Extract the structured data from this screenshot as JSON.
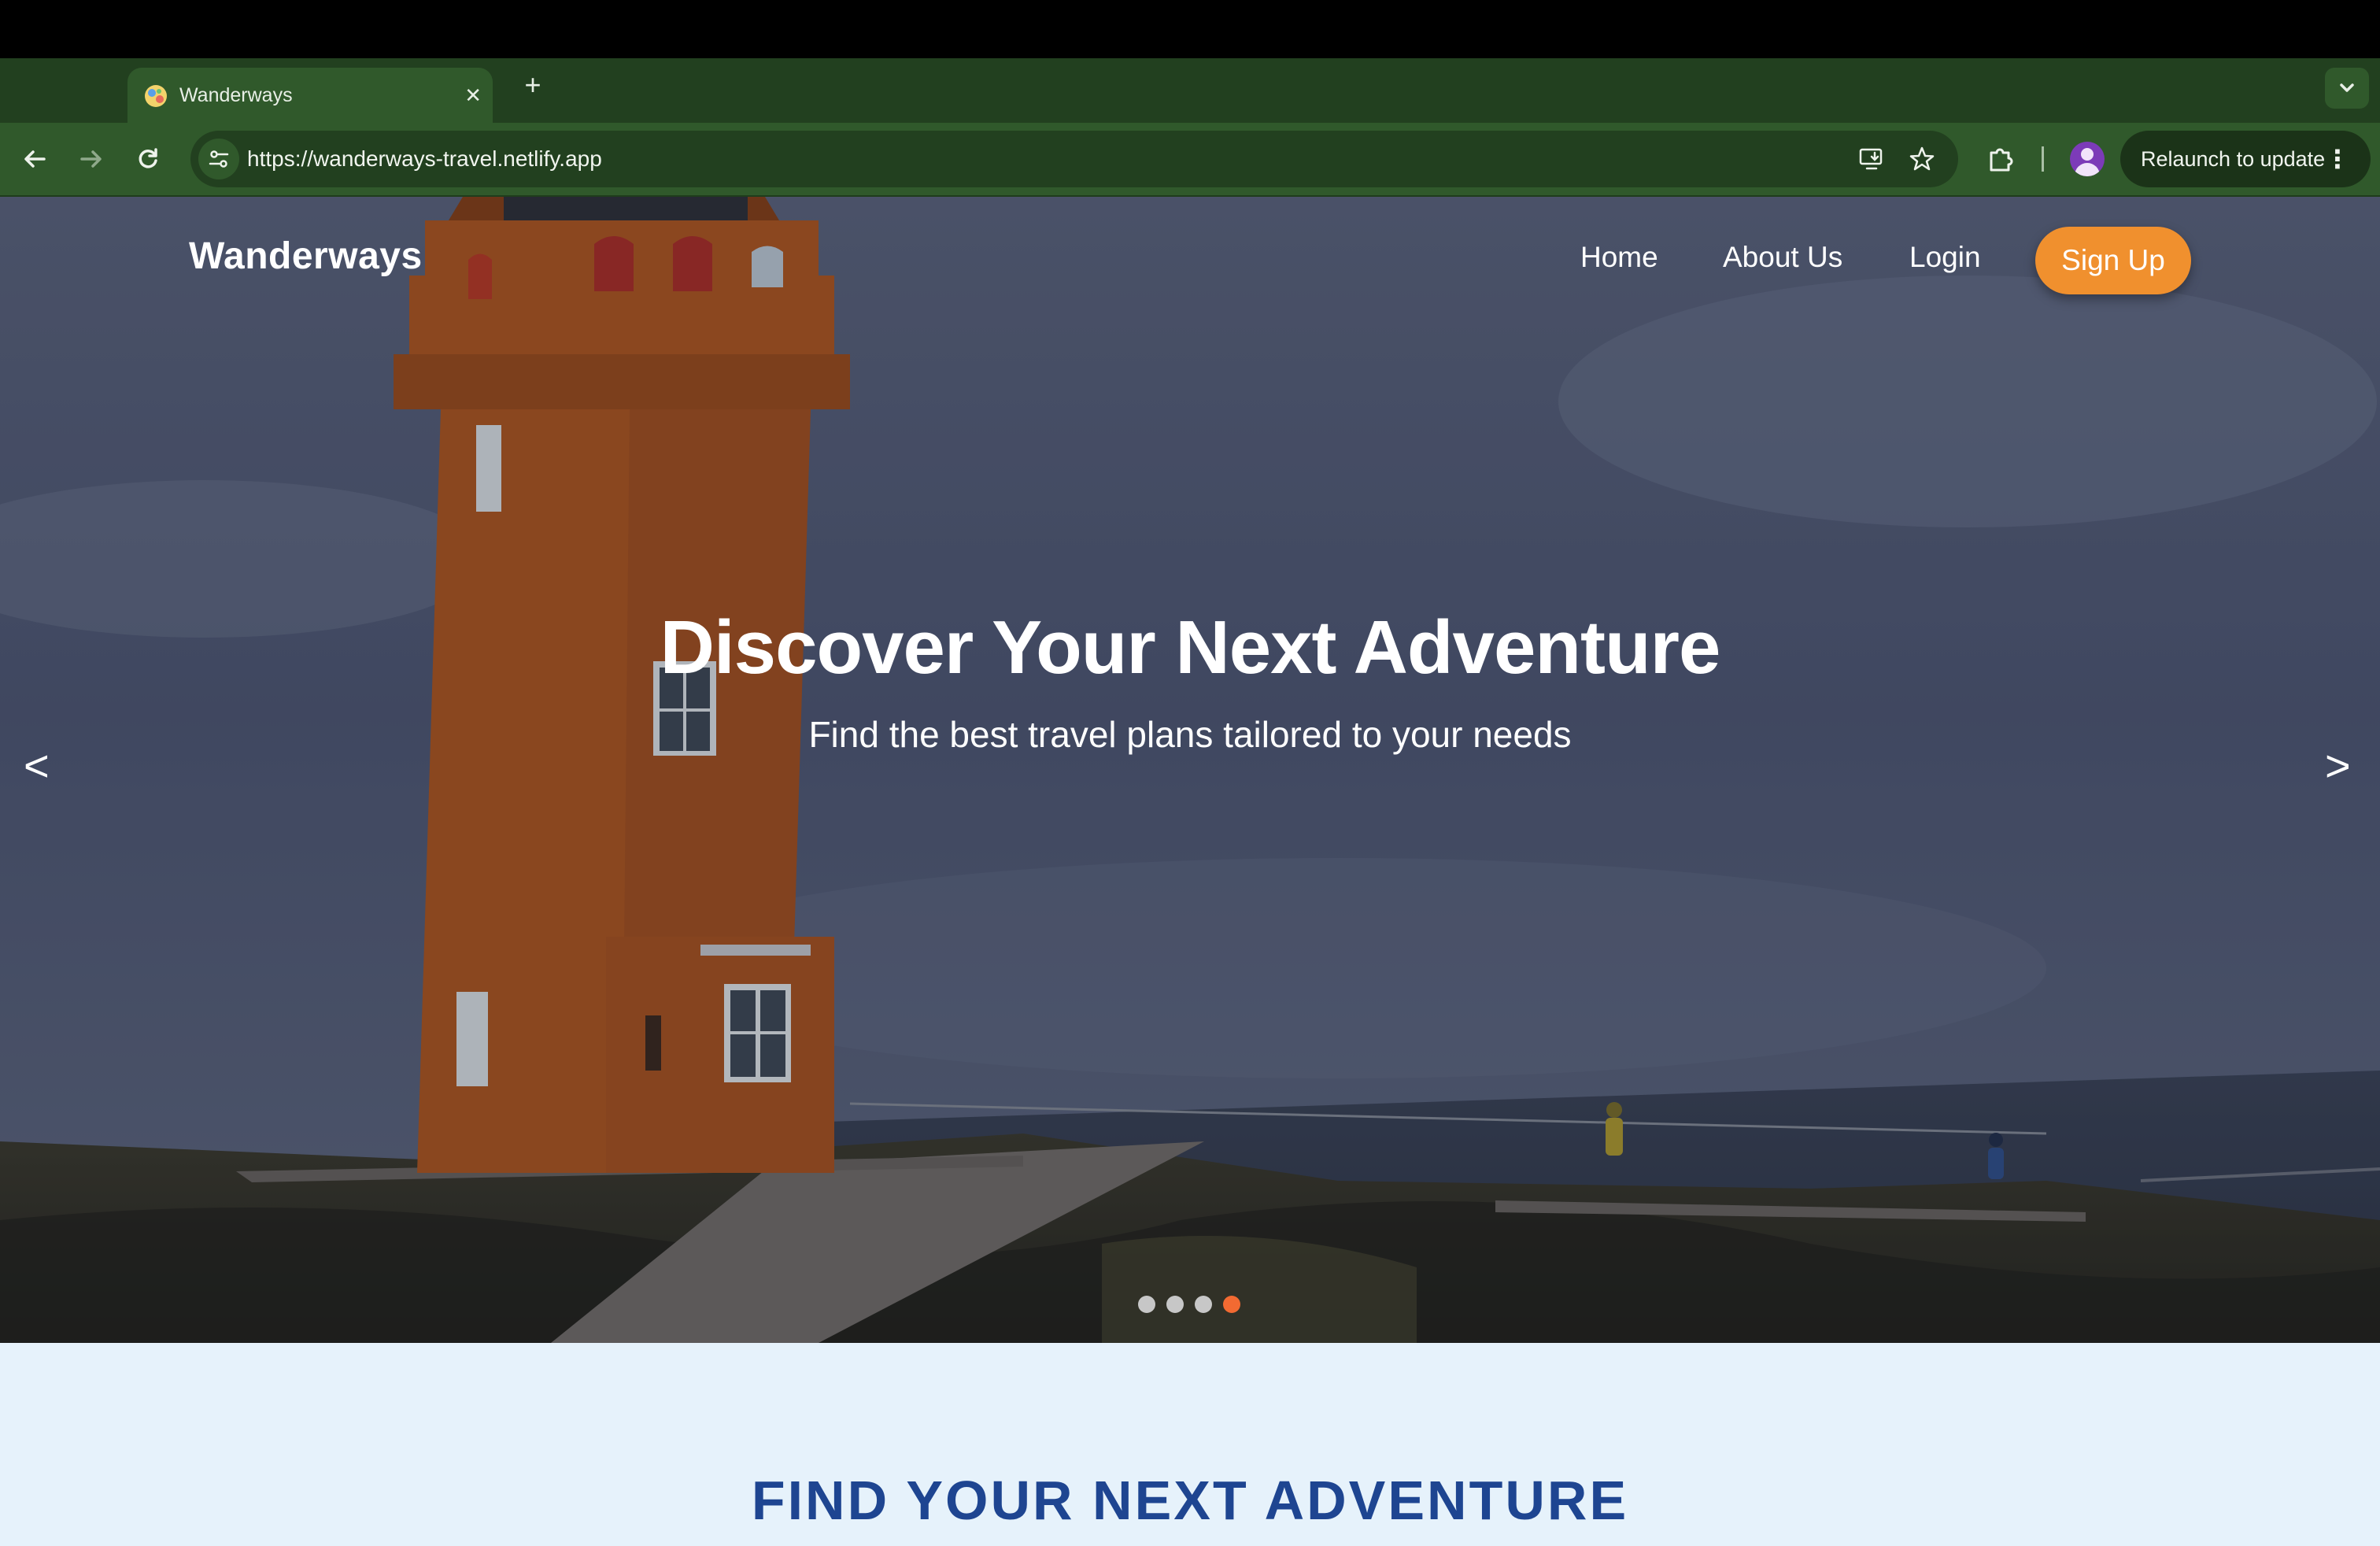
{
  "browser": {
    "tab": {
      "title": "Wanderways",
      "favicon": "globe-favicon"
    },
    "new_tab_label": "+",
    "close_label": "✕",
    "url": "https://wanderways-travel.netlify.app",
    "relaunch_label": "Relaunch to update",
    "menu_label": "⋮",
    "colors": {
      "frame": "#22401f",
      "toolbar": "#30592b"
    }
  },
  "site": {
    "brand": "Wanderways",
    "nav": {
      "home": "Home",
      "about": "About Us",
      "login": "Login",
      "signup": "Sign Up"
    },
    "colors": {
      "accent": "#f0902e",
      "heading": "#1e4591",
      "section_bg": "#e6f2fb"
    }
  },
  "hero": {
    "title": "Discover Your Next Adventure",
    "subtitle": "Find the best travel plans tailored to your needs",
    "prev_label": "<",
    "next_label": ">",
    "slides": {
      "count": 4,
      "active_index": 3
    }
  },
  "section": {
    "title": "FIND YOUR NEXT ADVENTURE"
  }
}
